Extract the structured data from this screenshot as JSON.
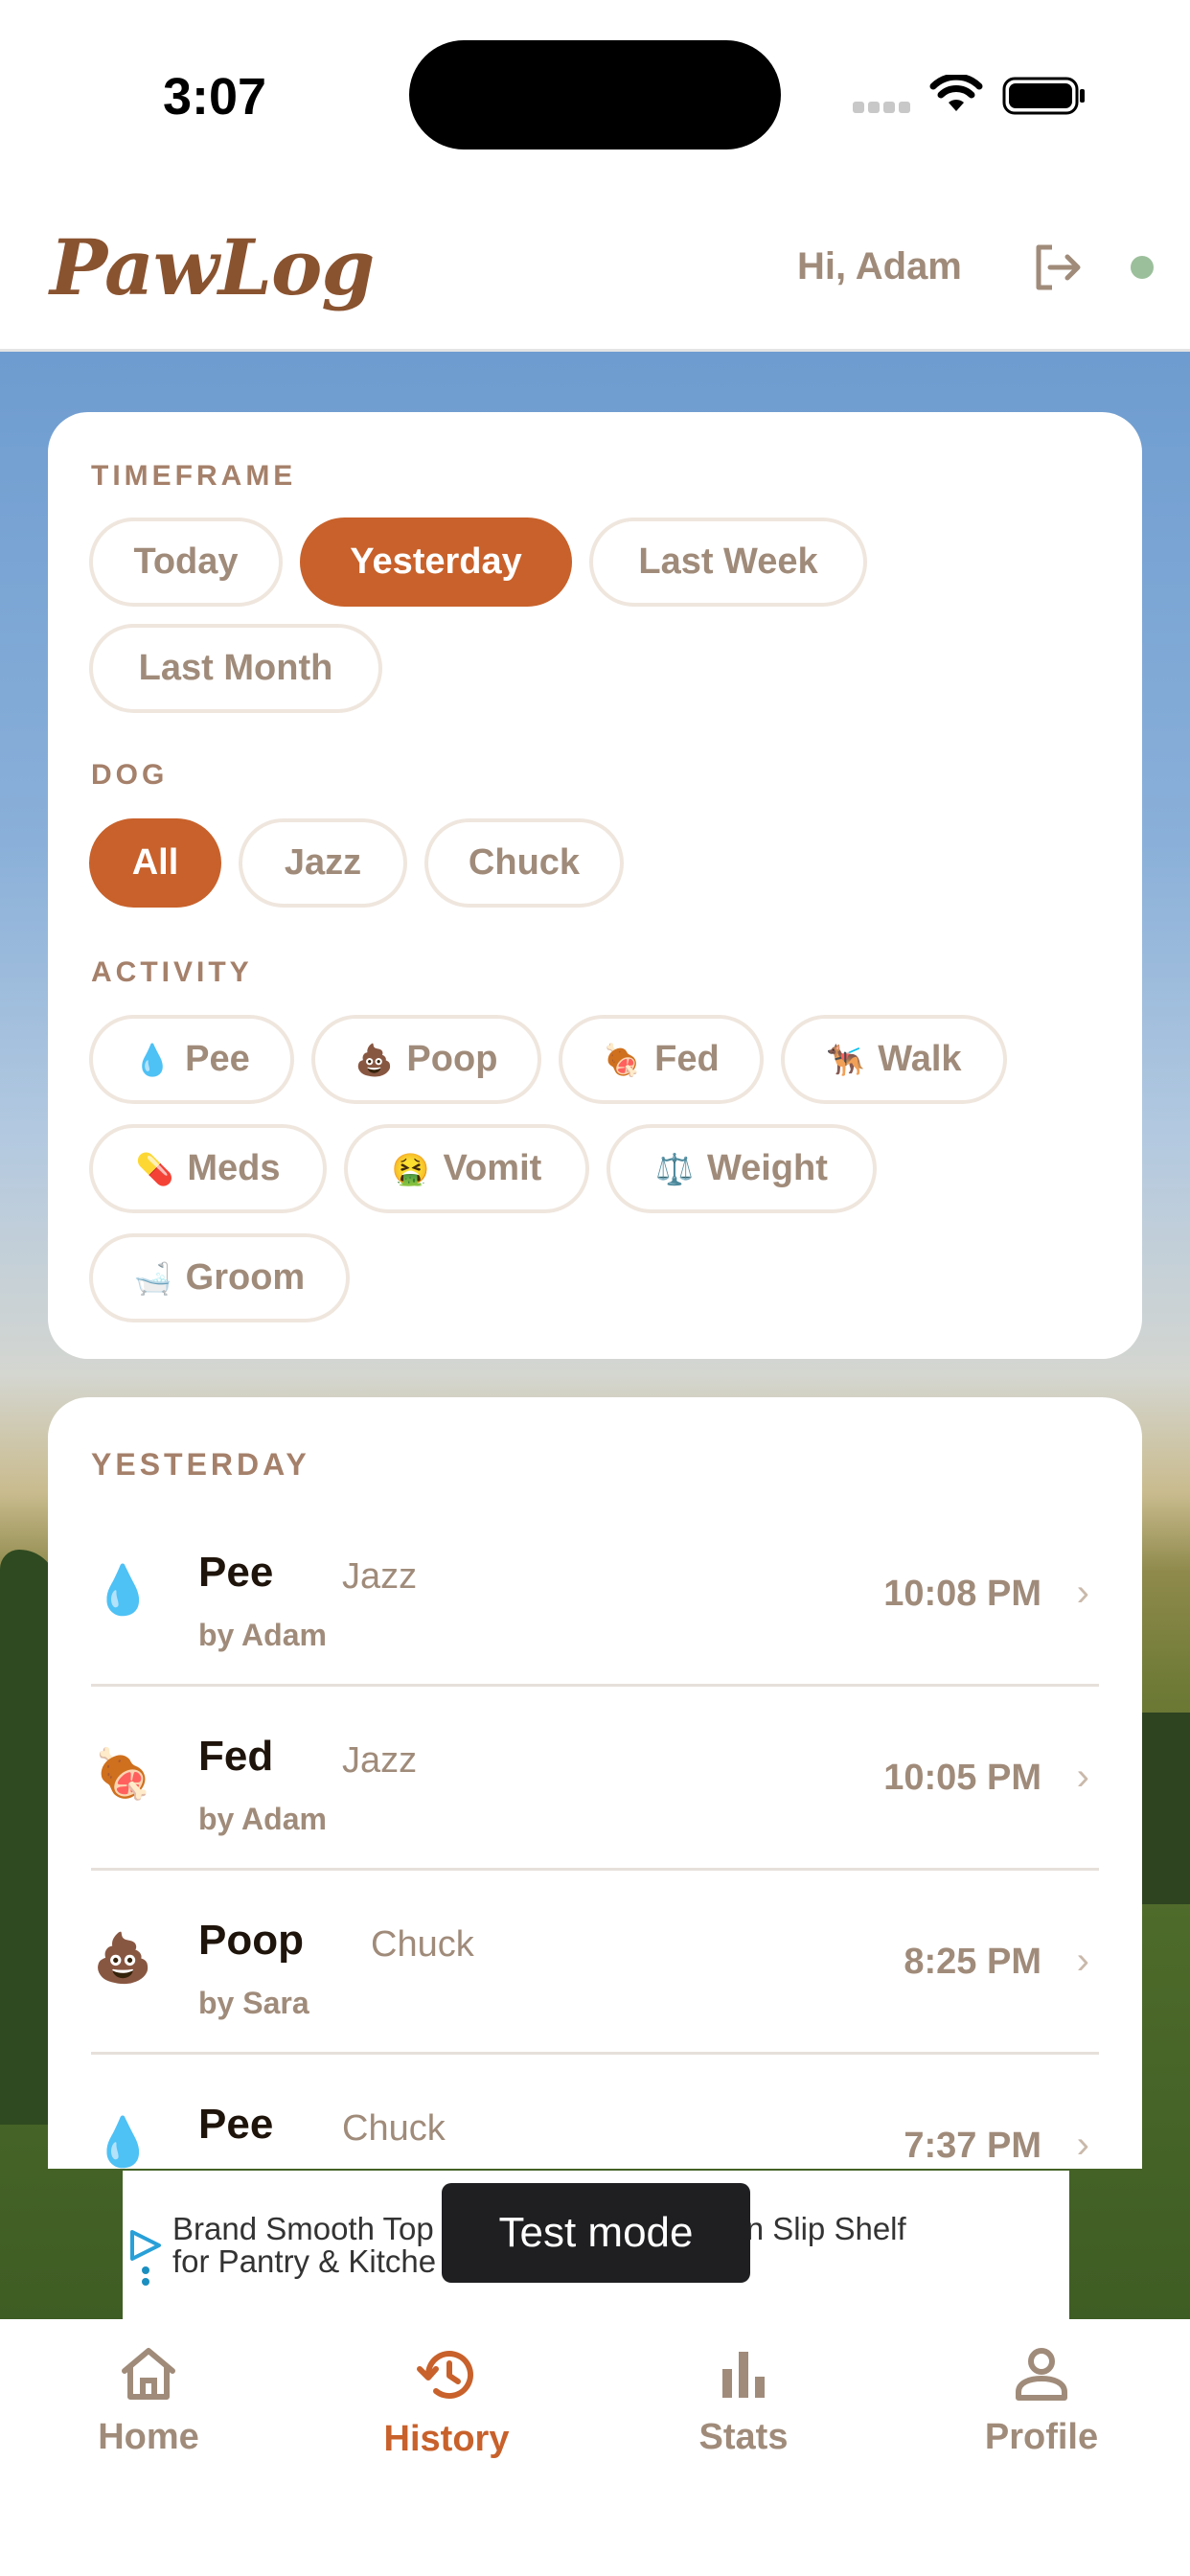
{
  "status_bar": {
    "time": "3:07"
  },
  "header": {
    "logo": "PawLog",
    "greeting": "Hi, Adam"
  },
  "filters": {
    "timeframe_label": "TIMEFRAME",
    "timeframe_options": [
      "Today",
      "Yesterday",
      "Last Week",
      "Last Month"
    ],
    "timeframe_selected": "Yesterday",
    "dog_label": "DOG",
    "dog_options": [
      "All",
      "Jazz",
      "Chuck"
    ],
    "dog_selected": "All",
    "activity_label": "ACTIVITY",
    "activity_options": [
      {
        "emoji": "💧",
        "label": "Pee"
      },
      {
        "emoji": "💩",
        "label": "Poop"
      },
      {
        "emoji": "🍖",
        "label": "Fed"
      },
      {
        "emoji": "🐕‍🦺",
        "label": "Walk"
      },
      {
        "emoji": "💊",
        "label": "Meds"
      },
      {
        "emoji": "🤮",
        "label": "Vomit"
      },
      {
        "emoji": "⚖️",
        "label": "Weight"
      },
      {
        "emoji": "🛁",
        "label": "Groom"
      }
    ]
  },
  "history": {
    "section_title": "YESTERDAY",
    "entries": [
      {
        "emoji": "💧",
        "activity": "Pee",
        "dog": "Jazz",
        "by": "by Adam",
        "time": "10:08 PM"
      },
      {
        "emoji": "🍖",
        "activity": "Fed",
        "dog": "Jazz",
        "by": "by Adam",
        "time": "10:05 PM"
      },
      {
        "emoji": "💩",
        "activity": "Poop",
        "dog": "Chuck",
        "by": "by Sara",
        "time": "8:25 PM"
      },
      {
        "emoji": "💧",
        "activity": "Pee",
        "dog": "Chuck",
        "by": "",
        "time": "7:37 PM"
      }
    ]
  },
  "ad": {
    "line1_left": "Brand Smooth Top",
    "line1_right": "n Slip Shelf",
    "line2": "for Pantry & Kitche",
    "test_mode": "Test mode"
  },
  "bottom_nav": {
    "items": [
      "Home",
      "History",
      "Stats",
      "Profile"
    ],
    "active": "History"
  },
  "colors": {
    "accent": "#c8612b",
    "muted_text": "#a08b7a",
    "logo": "#8a5330",
    "status_dot": "#9bbf9b"
  }
}
